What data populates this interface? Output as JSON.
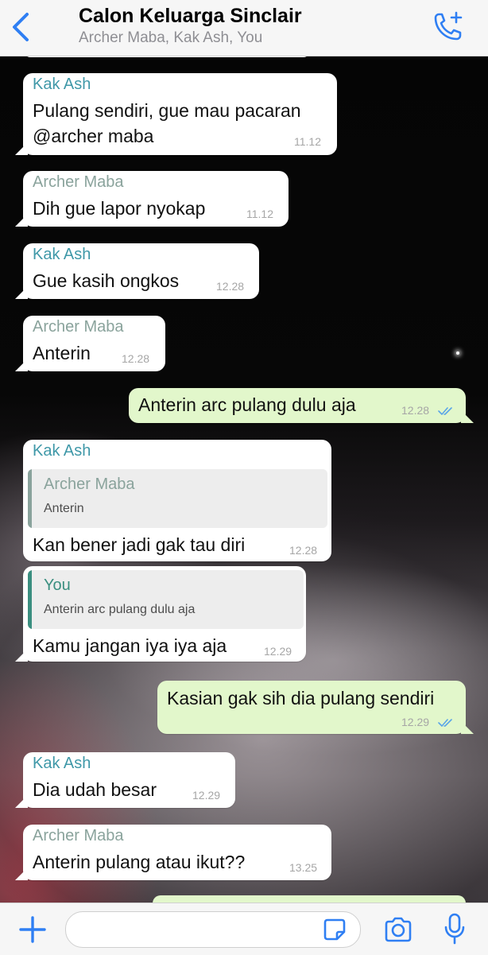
{
  "header": {
    "title": "Calon Keluarga Sinclair",
    "subtitle": "Archer Maba, Kak Ash, You",
    "back_icon": "chevron-left-icon",
    "call_icon": "phone-plus-icon"
  },
  "colors": {
    "accent": "#2f7ff3",
    "incoming_bubble": "#ffffff",
    "outgoing_bubble": "#e2f7cb",
    "kak_ash_name": "#3f98a8",
    "archer_maba_name": "#8aa39c",
    "you_name": "#3b8f80"
  },
  "messages": [
    {
      "sender": "Kak Ash",
      "lines": [
        "Pulang sendiri, gue mau pacaran",
        "@archer maba"
      ],
      "time": "11.12"
    },
    {
      "sender": "Archer Maba",
      "lines": [
        "Dih gue lapor nyokap"
      ],
      "time": "11.12"
    },
    {
      "sender": "Kak Ash",
      "lines": [
        "Gue kasih ongkos"
      ],
      "time": "12.28"
    },
    {
      "sender": "Archer Maba",
      "lines": [
        "Anterin"
      ],
      "time": "12.28"
    },
    {
      "direction": "out",
      "lines": [
        "Anterin arc pulang dulu aja"
      ],
      "time": "12.28"
    },
    {
      "sender": "Kak Ash",
      "quote": {
        "name": "Archer Maba",
        "text": "Anterin"
      },
      "lines": [
        "Kan bener jadi gak tau diri"
      ],
      "time": "12.28"
    },
    {
      "quote": {
        "name": "You",
        "text": "Anterin arc pulang dulu aja"
      },
      "lines": [
        "Kamu jangan iya iya aja"
      ],
      "time": "12.29"
    },
    {
      "direction": "out",
      "lines": [
        "Kasian gak sih dia pulang sendiri"
      ],
      "time": "12.29"
    },
    {
      "sender": "Kak Ash",
      "lines": [
        "Dia udah besar"
      ],
      "time": "12.29"
    },
    {
      "sender": "Archer Maba",
      "lines": [
        "Anterin pulang atau ikut??"
      ],
      "time": "13.25"
    }
  ],
  "composer": {
    "placeholder": "",
    "plus_icon": "plus-icon",
    "sticker_icon": "sticker-icon",
    "camera_icon": "camera-icon",
    "mic_icon": "microphone-icon"
  }
}
